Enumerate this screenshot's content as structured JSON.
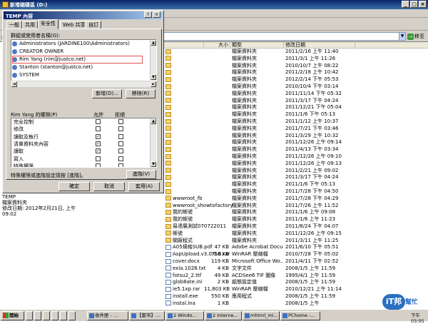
{
  "window": {
    "title": "新增磁碟區 (D:)"
  },
  "address": {
    "label": "網",
    "go_label": "移至"
  },
  "left_pane": {
    "folder_name": "TEMP",
    "folder_type": "檔案資料夾",
    "modified": "修改日期: 2012年2月21日, 上午 09:02"
  },
  "columns": {
    "size": "大小",
    "type": "類型",
    "modified": "修改日期"
  },
  "files": [
    {
      "name": "",
      "size": "",
      "type": "檔案資料夾",
      "date": "2011/2/16 上午 11:40",
      "icon": "folder"
    },
    {
      "name": "",
      "size": "",
      "type": "檔案資料夾",
      "date": "2011/3/1 上午 11:26",
      "icon": "folder"
    },
    {
      "name": "",
      "size": "",
      "type": "檔案資料夾",
      "date": "2010/10/7 上午 08:22",
      "icon": "folder"
    },
    {
      "name": "",
      "size": "",
      "type": "檔案資料夾",
      "date": "2011/2/18 上午 10:42",
      "icon": "folder"
    },
    {
      "name": "",
      "size": "",
      "type": "檔案資料夾",
      "date": "2012/2/14 下午 05:53",
      "icon": "folder"
    },
    {
      "name": "",
      "size": "",
      "type": "檔案資料夾",
      "date": "2010/10/4 下午 03:14",
      "icon": "folder"
    },
    {
      "name": "",
      "size": "",
      "type": "檔案資料夾",
      "date": "2011/11/14 下午 05:32",
      "icon": "folder"
    },
    {
      "name": "",
      "size": "",
      "type": "檔案資料夾",
      "date": "2011/3/17 下午 04:24",
      "icon": "folder"
    },
    {
      "name": "",
      "size": "",
      "type": "檔案資料夾",
      "date": "2011/12/21 下午 05:04",
      "icon": "folder"
    },
    {
      "name": "",
      "size": "",
      "type": "檔案資料夾",
      "date": "2011/1/6 下午 05:13",
      "icon": "folder"
    },
    {
      "name": "",
      "size": "",
      "type": "檔案資料夾",
      "date": "2011/1/12 上午 10:37",
      "icon": "folder"
    },
    {
      "name": "",
      "size": "",
      "type": "檔案資料夾",
      "date": "2011/7/21 下午 03:46",
      "icon": "folder"
    },
    {
      "name": "",
      "size": "",
      "type": "檔案資料夾",
      "date": "2011/3/29 上午 10:32",
      "icon": "folder"
    },
    {
      "name": "",
      "size": "",
      "type": "檔案資料夾",
      "date": "2011/12/26 上午 09:14",
      "icon": "folder"
    },
    {
      "name": "",
      "size": "",
      "type": "檔案資料夾",
      "date": "2011/4/13 下午 03:34",
      "icon": "folder"
    },
    {
      "name": "",
      "size": "",
      "type": "檔案資料夾",
      "date": "2011/12/26 上午 09:10",
      "icon": "folder"
    },
    {
      "name": "",
      "size": "",
      "type": "檔案資料夾",
      "date": "2011/12/26 上午 09:13",
      "icon": "folder"
    },
    {
      "name": "",
      "size": "",
      "type": "檔案資料夾",
      "date": "2011/2/21 上午 09:02",
      "icon": "folder"
    },
    {
      "name": "",
      "size": "",
      "type": "檔案資料夾",
      "date": "2011/3/17 下午 04:24",
      "icon": "folder"
    },
    {
      "name": "",
      "size": "",
      "type": "檔案資料夾",
      "date": "2011/1/6 下午 05:13",
      "icon": "folder"
    },
    {
      "name": "",
      "size": "",
      "type": "檔案資料夾",
      "date": "2011/7/28 下午 04:50",
      "icon": "folder"
    },
    {
      "name": "wwwroot_fb",
      "size": "",
      "type": "檔案資料夾",
      "date": "2011/7/28 下午 04:29",
      "icon": "folder"
    },
    {
      "name": "wwwroot_showtofactory",
      "size": "",
      "type": "檔案資料夾",
      "date": "2011/7/26 上午 11:52",
      "icon": "folder"
    },
    {
      "name": "我的帳號",
      "size": "",
      "type": "檔案資料夾",
      "date": "2011/1/6 上午 09:08",
      "icon": "folder"
    },
    {
      "name": "我的帳號",
      "size": "",
      "type": "檔案資料夾",
      "date": "2011/1/6 上午 11:23",
      "icon": "folder"
    },
    {
      "name": "易達展測試070722011",
      "size": "",
      "type": "檔案資料夾",
      "date": "2011/8/24 下午 04:07",
      "icon": "folder"
    },
    {
      "name": "帳號",
      "size": "",
      "type": "檔案資料夾",
      "date": "2011/12/26 上午 09:15",
      "icon": "folder"
    },
    {
      "name": "關廠程式",
      "size": "",
      "type": "檔案資料夾",
      "date": "2011/3/11 上午 11:25",
      "icon": "folder"
    },
    {
      "name": "A05規格SUB.pdf",
      "size": "47 KB",
      "type": "Adobe Acrobat Docu...",
      "date": "2011/6/10 下午 05:51",
      "icon": "file"
    },
    {
      "name": "AspUpload.v3.0.0.6.rar",
      "size": "758 KB",
      "type": "WinRAR 壓縮檔",
      "date": "2010/7/28 下午 05:02",
      "icon": "file"
    },
    {
      "name": "cover.docx",
      "size": "119 KB",
      "type": "Microsoft Office Wo...",
      "date": "2011/4/11 下午 02:52",
      "icon": "file"
    },
    {
      "name": "exla.1028.txt",
      "size": "4 KB",
      "type": "文字文件",
      "date": "2008/1/5 上午 11:59",
      "icon": "file"
    },
    {
      "name": "fotsu2_2.ttf",
      "size": "49 KB",
      "type": "ACDSee6 TIF 圖像",
      "date": "1995/4/1 上午 11:59",
      "icon": "file"
    },
    {
      "name": "glob8ate.ini",
      "size": "2 KB",
      "type": "組態設定值",
      "date": "2008/1/5 上午 11:59",
      "icon": "file"
    },
    {
      "name": "ie5.1xp.rar",
      "size": "11,803 KB",
      "type": "WinRAR 壓縮檔",
      "date": "2010/12/21 上午 11:14",
      "icon": "file"
    },
    {
      "name": "install.exe",
      "size": "550 KB",
      "type": "應用程式",
      "date": "2008/1/5 上午 11:59",
      "icon": "file"
    },
    {
      "name": "instal.lna",
      "size": "1 KB",
      "type": "",
      "date": "2008/1/5 上午",
      "icon": "file"
    }
  ],
  "dialog": {
    "title": "TEMP 內容",
    "help": "?",
    "close": "×",
    "tabs": [
      "一般",
      "共用",
      "安全性",
      "Web 共享",
      "自訂"
    ],
    "group_label": "群組或使用者名稱(G):",
    "users": [
      "Administrators (JARDINE100\\Administrators)",
      "CREATOR OWNER",
      "Rim Yang (rim@justco.net)",
      "Stanton (stanton@justco.net)",
      "SYSTEM"
    ],
    "add_button": "新增(D)...",
    "remove_button": "移除(R)",
    "perm_label": "Rim Yang 的權限(P)",
    "allow": "允許",
    "deny": "拒絕",
    "permissions": [
      {
        "name": "完全控制",
        "allow": false,
        "deny": false
      },
      {
        "name": "修改",
        "allow": false,
        "deny": false
      },
      {
        "name": "讀取及執行",
        "allow": true,
        "deny": false
      },
      {
        "name": "清單資料夾內容",
        "allow": true,
        "deny": false
      },
      {
        "name": "讀取",
        "allow": true,
        "deny": false
      },
      {
        "name": "寫入",
        "allow": false,
        "deny": false
      },
      {
        "name": "特殊權限",
        "allow": false,
        "deny": false
      }
    ],
    "special_text": "特殊權限或進階設定請按 [進階]。",
    "advanced_button": "進階(V)",
    "ok": "確定",
    "cancel": "取消",
    "apply": "套用(A)"
  },
  "taskbar": {
    "start": "開始",
    "items": [
      "收件匣 - ...",
      "【都市】...",
      "2 Windo...",
      "2 Interne...",
      "mhtml_mi...",
      "PChome -..."
    ],
    "time": "下午 03:05"
  },
  "watermark": {
    "logo": "iT邦",
    "text": "幫忙"
  }
}
